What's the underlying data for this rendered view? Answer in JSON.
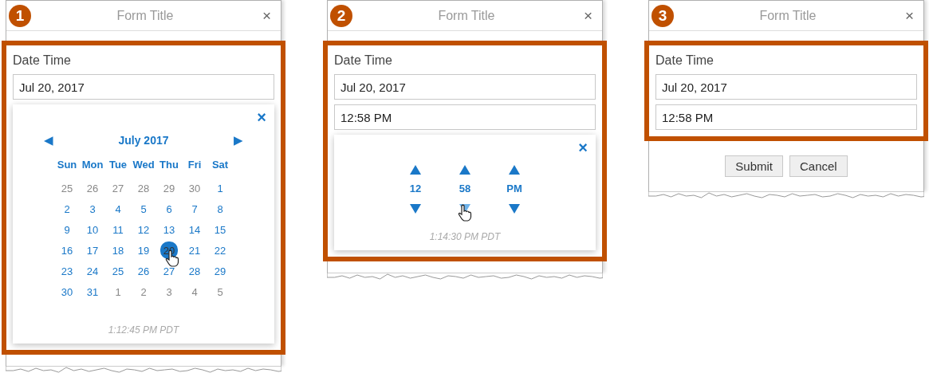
{
  "panels": [
    {
      "badge": "1",
      "title": "Form Title",
      "close": "×",
      "label": "Date Time",
      "fields": [
        "Jul 20, 2017"
      ],
      "popup": {
        "kind": "calendar",
        "close": "×",
        "prev": "◀",
        "next": "▶",
        "month": "July 2017",
        "weekdays": [
          "Sun",
          "Mon",
          "Tue",
          "Wed",
          "Thu",
          "Fri",
          "Sat"
        ],
        "days": [
          {
            "day": "25",
            "kind": "other",
            "selected": false
          },
          {
            "day": "26",
            "kind": "other",
            "selected": false
          },
          {
            "day": "27",
            "kind": "other",
            "selected": false
          },
          {
            "day": "28",
            "kind": "other",
            "selected": false
          },
          {
            "day": "29",
            "kind": "other",
            "selected": false
          },
          {
            "day": "30",
            "kind": "other",
            "selected": false
          },
          {
            "day": "1",
            "kind": "current",
            "selected": false
          },
          {
            "day": "2",
            "kind": "current",
            "selected": false
          },
          {
            "day": "3",
            "kind": "current",
            "selected": false
          },
          {
            "day": "4",
            "kind": "current",
            "selected": false
          },
          {
            "day": "5",
            "kind": "current",
            "selected": false
          },
          {
            "day": "6",
            "kind": "current",
            "selected": false
          },
          {
            "day": "7",
            "kind": "current",
            "selected": false
          },
          {
            "day": "8",
            "kind": "current",
            "selected": false
          },
          {
            "day": "9",
            "kind": "current",
            "selected": false
          },
          {
            "day": "10",
            "kind": "current",
            "selected": false
          },
          {
            "day": "11",
            "kind": "current",
            "selected": false
          },
          {
            "day": "12",
            "kind": "current",
            "selected": false
          },
          {
            "day": "13",
            "kind": "current",
            "selected": false
          },
          {
            "day": "14",
            "kind": "current",
            "selected": false
          },
          {
            "day": "15",
            "kind": "current",
            "selected": false
          },
          {
            "day": "16",
            "kind": "current",
            "selected": false
          },
          {
            "day": "17",
            "kind": "current",
            "selected": false
          },
          {
            "day": "18",
            "kind": "current",
            "selected": false
          },
          {
            "day": "19",
            "kind": "current",
            "selected": false
          },
          {
            "day": "20",
            "kind": "current",
            "selected": true
          },
          {
            "day": "21",
            "kind": "current",
            "selected": false
          },
          {
            "day": "22",
            "kind": "current",
            "selected": false
          },
          {
            "day": "23",
            "kind": "current",
            "selected": false
          },
          {
            "day": "24",
            "kind": "current",
            "selected": false
          },
          {
            "day": "25",
            "kind": "current",
            "selected": false
          },
          {
            "day": "26",
            "kind": "current",
            "selected": false
          },
          {
            "day": "27",
            "kind": "current",
            "selected": false
          },
          {
            "day": "28",
            "kind": "current",
            "selected": false
          },
          {
            "day": "29",
            "kind": "current",
            "selected": false
          },
          {
            "day": "30",
            "kind": "current",
            "selected": false
          },
          {
            "day": "31",
            "kind": "current",
            "selected": false
          },
          {
            "day": "1",
            "kind": "other",
            "selected": false
          },
          {
            "day": "2",
            "kind": "other",
            "selected": false
          },
          {
            "day": "3",
            "kind": "other",
            "selected": false
          },
          {
            "day": "4",
            "kind": "other",
            "selected": false
          },
          {
            "day": "5",
            "kind": "other",
            "selected": false
          }
        ],
        "footer": "1:12:45 PM PDT"
      }
    },
    {
      "badge": "2",
      "title": "Form Title",
      "close": "×",
      "label": "Date Time",
      "fields": [
        "Jul 20, 2017",
        "12:58 PM"
      ],
      "popup": {
        "kind": "time",
        "close": "×",
        "spinners": [
          {
            "value": "12",
            "down_highlighted": false
          },
          {
            "value": "58",
            "down_highlighted": true
          },
          {
            "value": "PM",
            "down_highlighted": false
          }
        ],
        "footer": "1:14:30 PM PDT"
      }
    },
    {
      "badge": "3",
      "title": "Form Title",
      "close": "×",
      "label": "Date Time",
      "fields": [
        "Jul 20, 2017",
        "12:58 PM"
      ],
      "buttons": [
        "Submit",
        "Cancel"
      ]
    }
  ]
}
